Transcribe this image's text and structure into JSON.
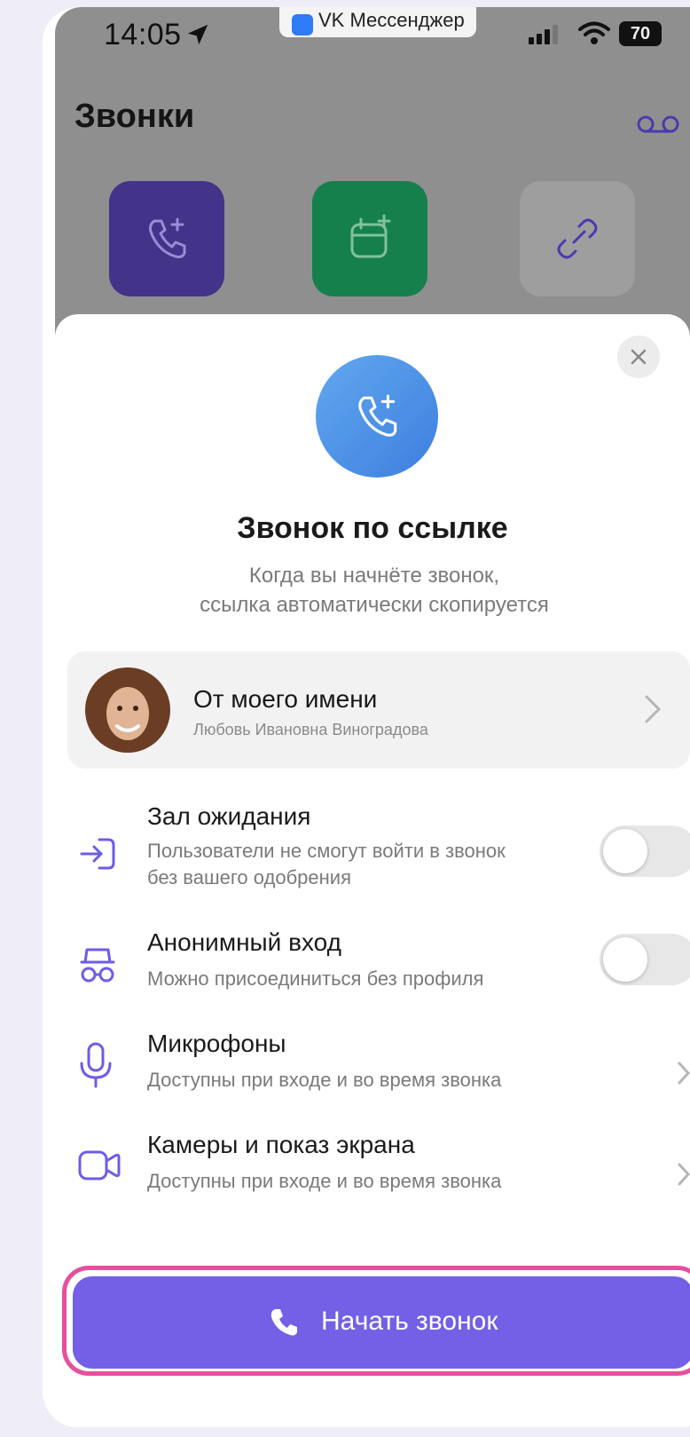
{
  "status_bar": {
    "time": "14:05",
    "app_name": "VK Мессенджер",
    "battery": "70"
  },
  "header": {
    "title": "Звонки",
    "actions": [
      {
        "icon": "phone-plus-icon",
        "color": "#433389"
      },
      {
        "icon": "calendar-plus-icon",
        "color": "#16804c"
      },
      {
        "icon": "link-icon",
        "color": "#9e9e9e"
      }
    ]
  },
  "sheet": {
    "icon": "phone-plus-icon",
    "title": "Звонок по ссылке",
    "subtitle_line1": "Когда вы начнёте звонок,",
    "subtitle_line2": "ссылка автоматически скопируется",
    "author": {
      "title": "От моего имени",
      "name": "Любовь Ивановна Виноградова"
    },
    "options": [
      {
        "icon": "enter-icon",
        "title": "Зал ожидания",
        "desc_line1": "Пользователи не смогут войти в звонок",
        "desc_line2": "без вашего одобрения",
        "control": "toggle",
        "enabled": false
      },
      {
        "icon": "incognito-icon",
        "title": "Анонимный вход",
        "desc_line1": "Можно присоединиться без профиля",
        "control": "toggle",
        "enabled": false
      },
      {
        "icon": "microphone-icon",
        "title": "Микрофоны",
        "desc_line1": "Доступны при входе и во время звонка",
        "control": "chevron"
      },
      {
        "icon": "camera-icon",
        "title": "Камеры и показ экрана",
        "desc_line1": "Доступны при входе и во время звонка",
        "control": "chevron"
      }
    ],
    "start_button": {
      "label": "Начать звонок",
      "color": "#7360e6",
      "highlight_color": "#e5509c"
    }
  }
}
